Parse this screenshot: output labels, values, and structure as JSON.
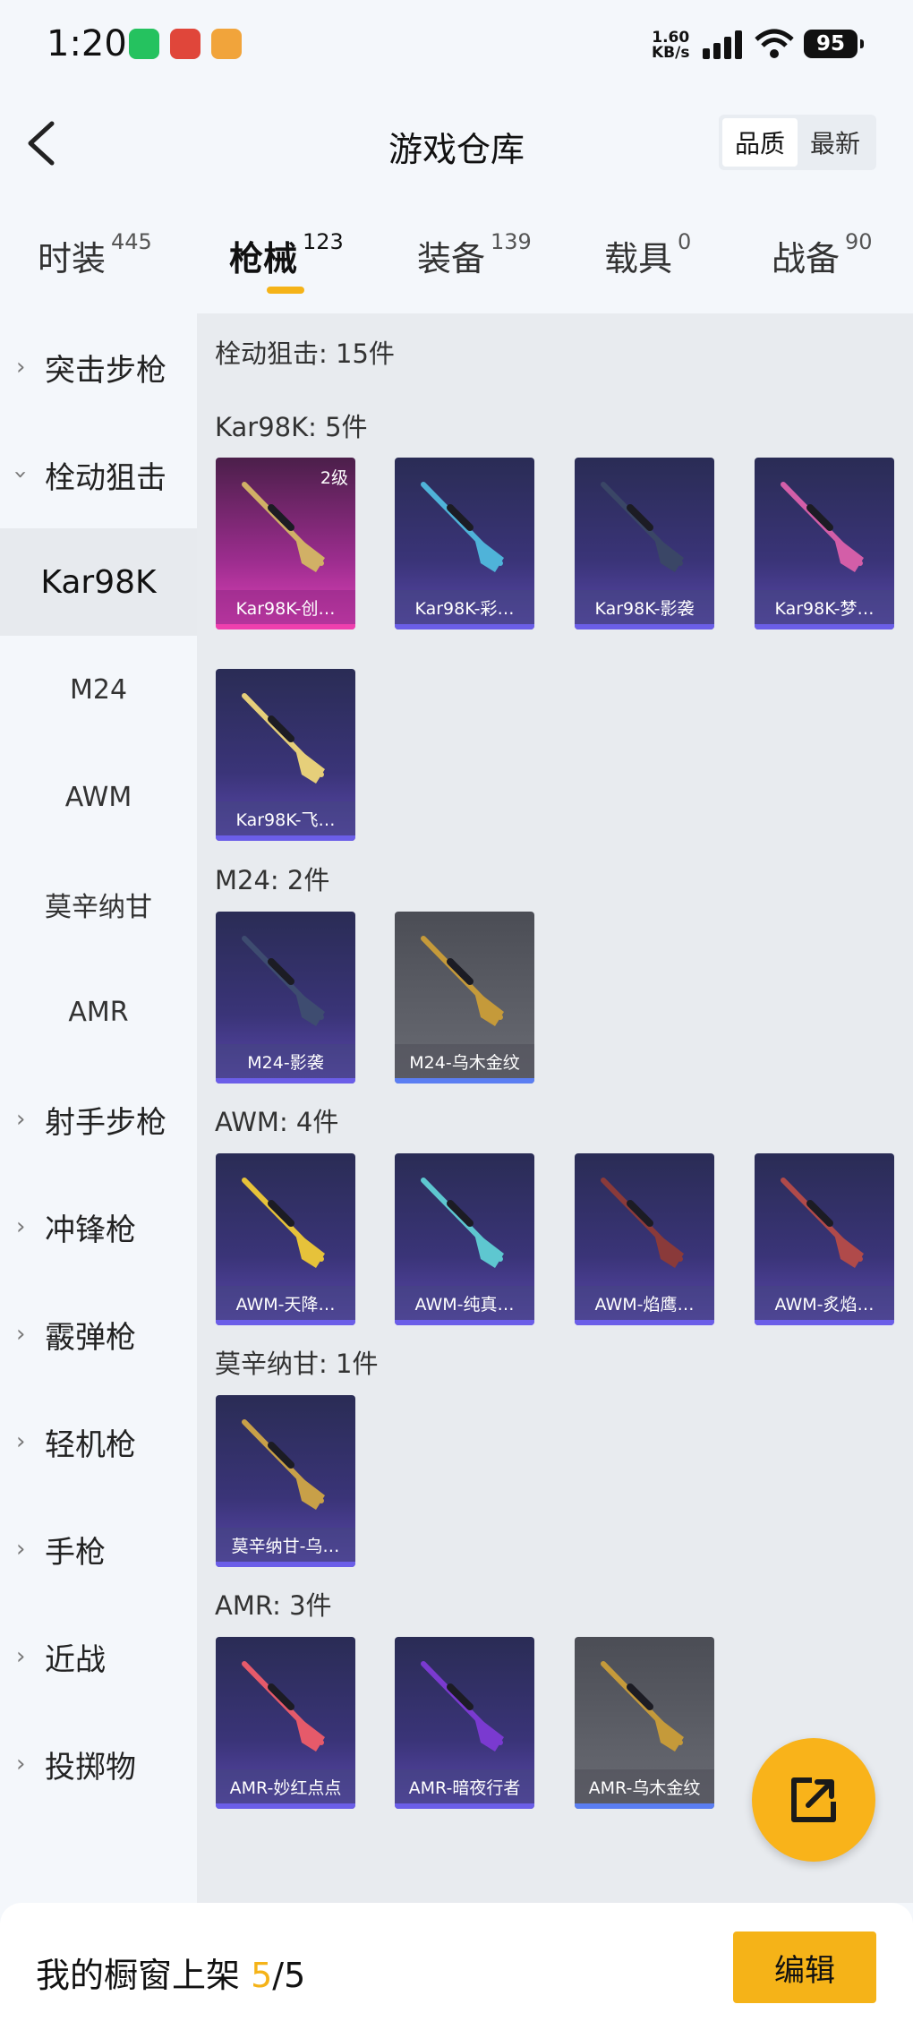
{
  "status_bar": {
    "time": "1:20",
    "net_speed_value": "1.60",
    "net_speed_unit": "KB/s",
    "battery": "95"
  },
  "header": {
    "title": "游戏仓库",
    "sort_options": [
      "品质",
      "最新"
    ],
    "sort_selected": "品质"
  },
  "tabs": [
    {
      "label": "时装",
      "count": "445"
    },
    {
      "label": "枪械",
      "count": "123",
      "active": true
    },
    {
      "label": "装备",
      "count": "139"
    },
    {
      "label": "载具",
      "count": "0"
    },
    {
      "label": "战备",
      "count": "90"
    }
  ],
  "sidebar": {
    "categories": [
      "突击步枪",
      "栓动狙击",
      "射手步枪",
      "冲锋枪",
      "霰弹枪",
      "轻机枪",
      "手枪",
      "近战",
      "投掷物"
    ],
    "subs": [
      "Kar98K",
      "M24",
      "AWM",
      "莫辛纳甘",
      "AMR"
    ],
    "selected_sub": "Kar98K"
  },
  "content": {
    "section_title": "栓动狙击: 15件",
    "groups": [
      {
        "title": "Kar98K: 5件",
        "items": [
          {
            "name": "Kar98K-创…",
            "badge": "2级",
            "tier": "pink",
            "gun": "#d1b066"
          },
          {
            "name": "Kar98K-彩…",
            "tier": "purple",
            "gun": "#4fb3d9"
          },
          {
            "name": "Kar98K-影袭",
            "tier": "purple",
            "gun": "#3a4666"
          },
          {
            "name": "Kar98K-梦…",
            "tier": "purple",
            "gun": "#d35ea8"
          },
          {
            "name": "Kar98K-飞…",
            "tier": "purple",
            "gun": "#e6cf7a"
          }
        ]
      },
      {
        "title": "M24: 2件",
        "items": [
          {
            "name": "M24-影袭",
            "tier": "purple",
            "gun": "#3e4c70"
          },
          {
            "name": "M24-乌木金纹",
            "tier": "gray",
            "gun": "#c59a3a"
          }
        ]
      },
      {
        "title": "AWM: 4件",
        "items": [
          {
            "name": "AWM-天降…",
            "tier": "purple",
            "gun": "#e6c23a"
          },
          {
            "name": "AWM-纯真…",
            "tier": "purple",
            "gun": "#5ec7d0"
          },
          {
            "name": "AWM-焰鹰…",
            "tier": "purple",
            "gun": "#8a3a3a"
          },
          {
            "name": "AWM-炙焰…",
            "tier": "purple",
            "gun": "#b04a4a"
          }
        ]
      },
      {
        "title": "莫辛纳甘: 1件",
        "items": [
          {
            "name": "莫辛纳甘-乌…",
            "tier": "purple",
            "gun": "#c8a048"
          }
        ]
      },
      {
        "title": "AMR: 3件",
        "items": [
          {
            "name": "AMR-妙红点点",
            "tier": "purple",
            "gun": "#e65a6a"
          },
          {
            "name": "AMR-暗夜行者",
            "tier": "purple",
            "gun": "#7a3ad0"
          },
          {
            "name": "AMR-乌木金纹",
            "tier": "gray",
            "gun": "#c59a3a"
          }
        ]
      }
    ]
  },
  "bottom_bar": {
    "label": "我的橱窗上架",
    "count_current": "5",
    "count_sep_total": "/5",
    "edit_label": "编辑"
  },
  "colors": {
    "accent": "#f5b318",
    "panel_bg": "#e8ebef"
  }
}
